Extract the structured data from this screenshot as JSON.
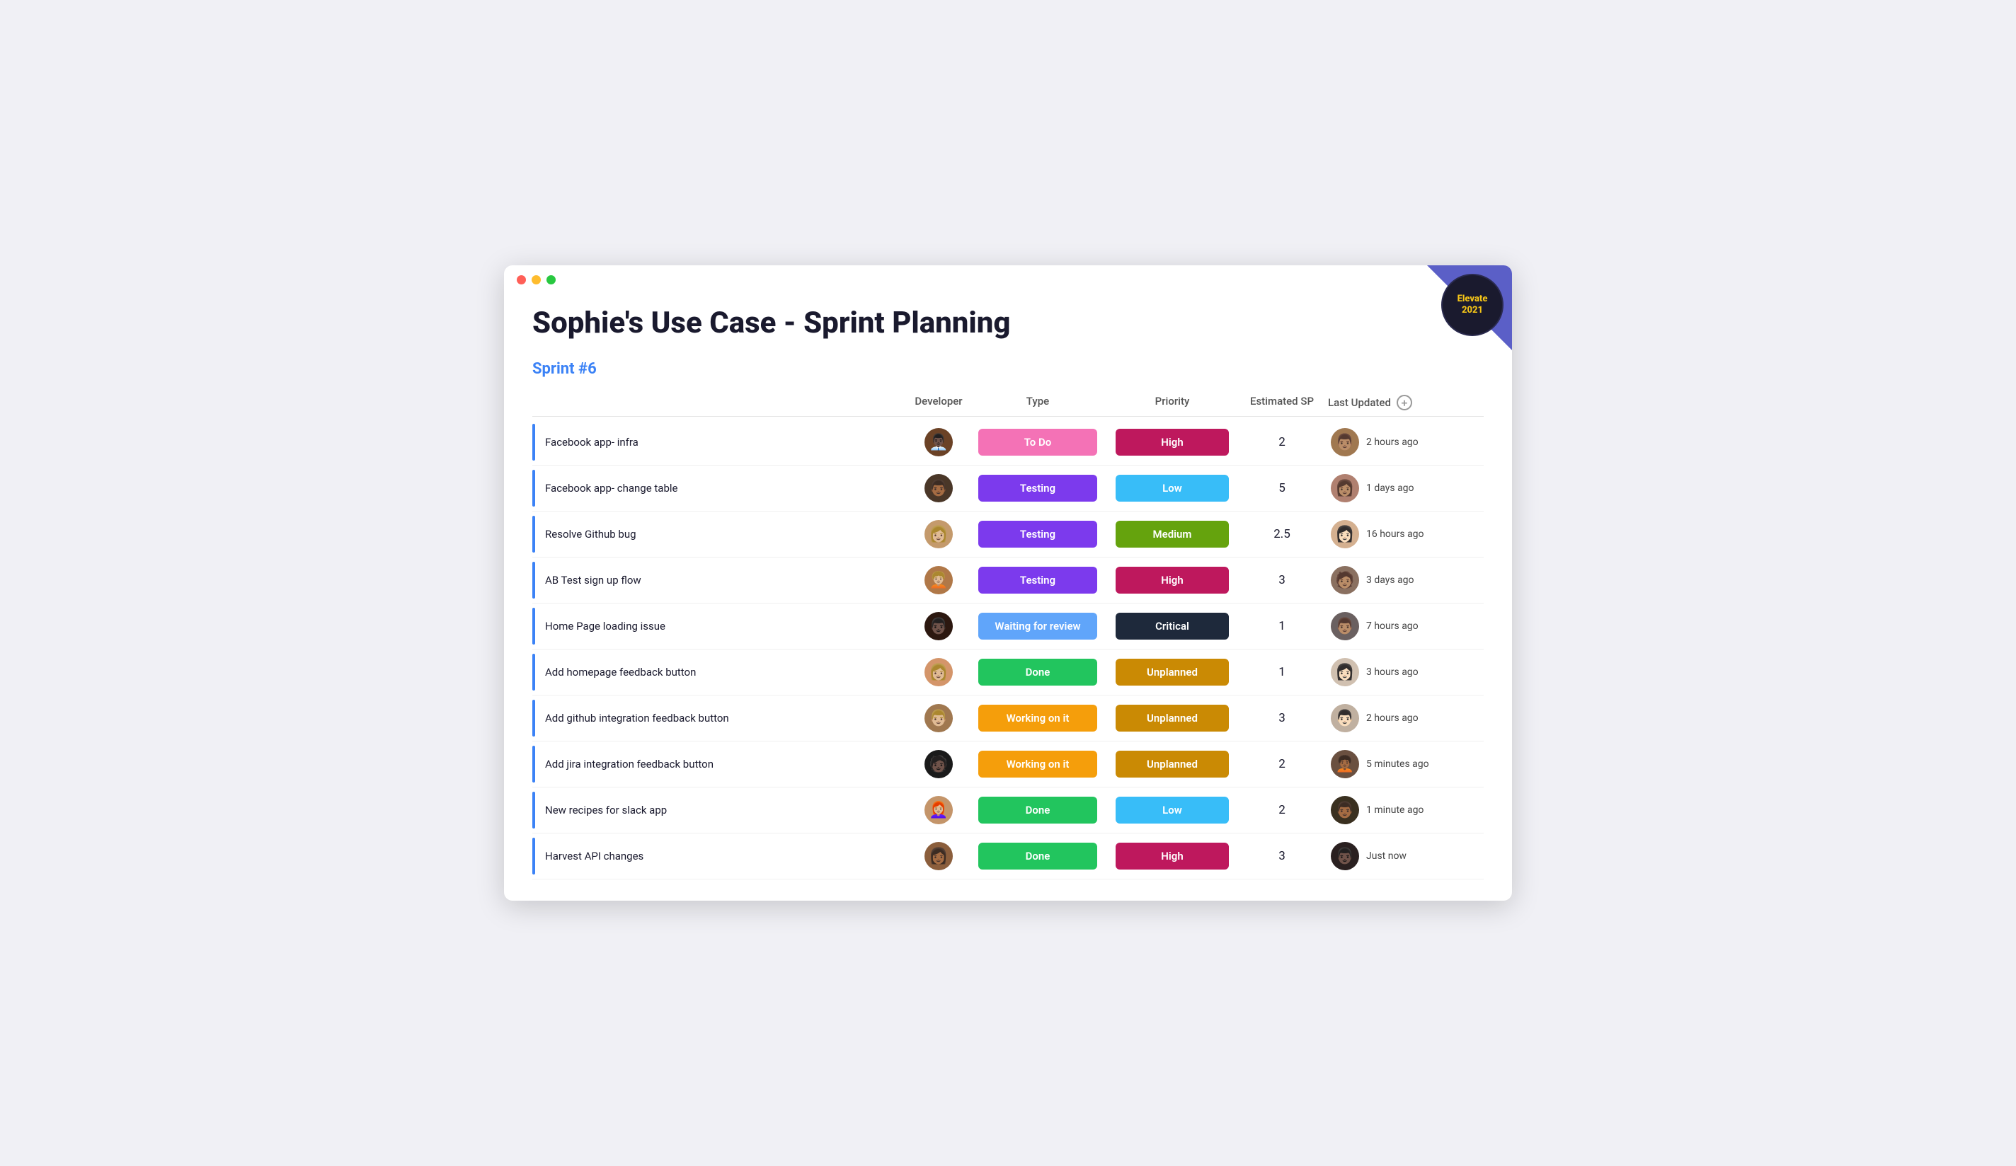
{
  "window": {
    "title": "Sophie's Use Case - Sprint Planning"
  },
  "badge": {
    "line1": "Elevate",
    "line2": "2021"
  },
  "sprint": {
    "label": "Sprint #6"
  },
  "headers": {
    "name": "",
    "developer": "Developer",
    "type": "Type",
    "priority": "Priority",
    "estimated_sp": "Estimated SP",
    "last_updated": "Last Updated"
  },
  "rows": [
    {
      "name": "Facebook app- infra",
      "developer_emoji": "👨🏿‍💼",
      "developer_bg": "#6b4226",
      "type": "To Do",
      "type_class": "badge-todo",
      "priority": "High",
      "priority_class": "p-high",
      "sp": "2",
      "last_updated": "2 hours ago",
      "updater_emoji": "👨🏽"
    },
    {
      "name": "Facebook app- change table",
      "developer_emoji": "👨🏾",
      "developer_bg": "#4a3728",
      "type": "Testing",
      "type_class": "badge-testing",
      "priority": "Low",
      "priority_class": "p-low",
      "sp": "5",
      "last_updated": "1 days ago",
      "updater_emoji": "👩🏽"
    },
    {
      "name": "Resolve Github bug",
      "developer_emoji": "👩🏼",
      "developer_bg": "#c49a6c",
      "type": "Testing",
      "type_class": "badge-testing",
      "priority": "Medium",
      "priority_class": "p-medium",
      "sp": "2.5",
      "last_updated": "16 hours ago",
      "updater_emoji": "👩🏻"
    },
    {
      "name": "AB Test sign up flow",
      "developer_emoji": "🧑🏼‍🦱",
      "developer_bg": "#b07848",
      "type": "Testing",
      "type_class": "badge-testing",
      "priority": "High",
      "priority_class": "p-high",
      "sp": "3",
      "last_updated": "3 days ago",
      "updater_emoji": "🧑🏽"
    },
    {
      "name": "Home Page loading issue",
      "developer_emoji": "👨🏿",
      "developer_bg": "#2c1810",
      "type": "Waiting for review",
      "type_class": "badge-waiting",
      "priority": "Critical",
      "priority_class": "p-critical",
      "sp": "1",
      "last_updated": "7 hours ago",
      "updater_emoji": "👨🏽"
    },
    {
      "name": "Add homepage feedback button",
      "developer_emoji": "👩🏼",
      "developer_bg": "#d4956a",
      "type": "Done",
      "type_class": "badge-done",
      "priority": "Unplanned",
      "priority_class": "p-unplanned",
      "sp": "1",
      "last_updated": "3 hours ago",
      "updater_emoji": "👩🏻"
    },
    {
      "name": "Add github integration feedback button",
      "developer_emoji": "👨🏼",
      "developer_bg": "#a07850",
      "type": "Working on it",
      "type_class": "badge-working",
      "priority": "Unplanned",
      "priority_class": "p-unplanned",
      "sp": "3",
      "last_updated": "2 hours ago",
      "updater_emoji": "👨🏻"
    },
    {
      "name": "Add jira integration feedback button",
      "developer_emoji": "🧑🏿",
      "developer_bg": "#1a1a1a",
      "type": "Working on it",
      "type_class": "badge-working",
      "priority": "Unplanned",
      "priority_class": "p-unplanned",
      "sp": "2",
      "last_updated": "5 minutes ago",
      "updater_emoji": "🧑🏾‍🦱"
    },
    {
      "name": "New recipes for slack app",
      "developer_emoji": "👩🏼‍🦰",
      "developer_bg": "#c4956a",
      "type": "Done",
      "type_class": "badge-done",
      "priority": "Low",
      "priority_class": "p-low",
      "sp": "2",
      "last_updated": "1 minute ago",
      "updater_emoji": "👨🏾"
    },
    {
      "name": "Harvest API changes",
      "developer_emoji": "👩🏾",
      "developer_bg": "#8b5e3c",
      "type": "Done",
      "type_class": "badge-done",
      "priority": "High",
      "priority_class": "p-high",
      "sp": "3",
      "last_updated": "Just now",
      "updater_emoji": "👨🏿"
    }
  ]
}
